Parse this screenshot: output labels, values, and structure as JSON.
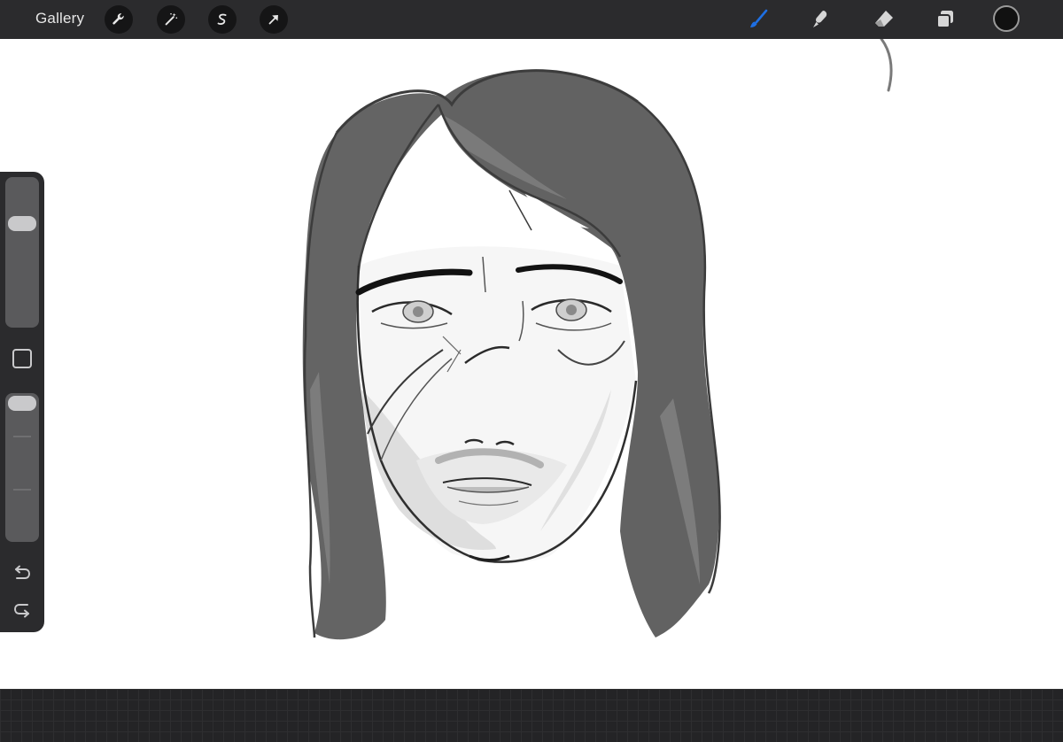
{
  "app": {
    "gallery_label": "Gallery"
  },
  "toolbar": {
    "left_tools": [
      {
        "name": "actions",
        "icon": "wrench-icon"
      },
      {
        "name": "adjustments",
        "icon": "magic-wand-icon"
      },
      {
        "name": "selection",
        "icon": "selection-s-icon"
      },
      {
        "name": "transform",
        "icon": "arrow-cursor-icon"
      }
    ],
    "right_tools": [
      {
        "name": "brush",
        "icon": "brush-icon",
        "active": true
      },
      {
        "name": "smudge",
        "icon": "smudge-icon",
        "active": false
      },
      {
        "name": "eraser",
        "icon": "eraser-icon",
        "active": false
      },
      {
        "name": "layers",
        "icon": "layers-icon",
        "active": false
      }
    ],
    "current_color": "#111111",
    "active_tool_color": "#1e6fe3"
  },
  "sidebar": {
    "brush_size": 0.28,
    "brush_opacity": 1.0,
    "modify_button_icon": "square-icon",
    "undo_icon": "undo-icon",
    "redo_icon": "redo-icon"
  },
  "canvas": {
    "content": "sketch-of-long-haired-face"
  }
}
